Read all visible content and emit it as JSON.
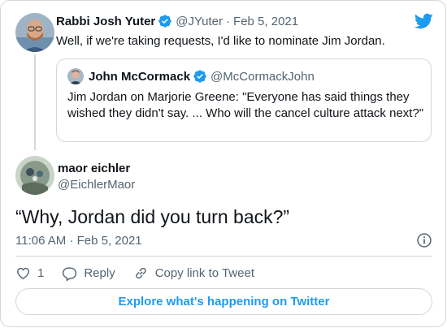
{
  "parent_tweet": {
    "name": "Rabbi Josh Yuter",
    "handle": "@JYuter",
    "separator": "·",
    "date": "Feb 5, 2021",
    "text": "Well, if we're taking requests, I'd like to nominate Jim Jordan."
  },
  "quoted_tweet": {
    "name": "John McCormack",
    "handle": "@McCormackJohn",
    "text": "Jim Jordan on Marjorie Greene: \"Everyone has said things they wished they didn't say. ... Who will the cancel culture attack next?\""
  },
  "main_tweet": {
    "name": "maor eichler",
    "handle": "@EichlerMaor",
    "text": "“Why, Jordan did you turn back?”",
    "timestamp": "11:06 AM · Feb 5, 2021"
  },
  "actions": {
    "like_count": "1",
    "reply_label": "Reply",
    "copy_link_label": "Copy link to Tweet"
  },
  "explore_label": "Explore what's happening on Twitter",
  "colors": {
    "accent": "#1d9bf0",
    "verified": "#1d9bf0",
    "secondary_text": "#536471",
    "border": "#cfd9de"
  },
  "icons": [
    "twitter-bird-icon",
    "verified-badge-icon",
    "info-icon",
    "heart-icon",
    "reply-icon",
    "link-icon"
  ]
}
